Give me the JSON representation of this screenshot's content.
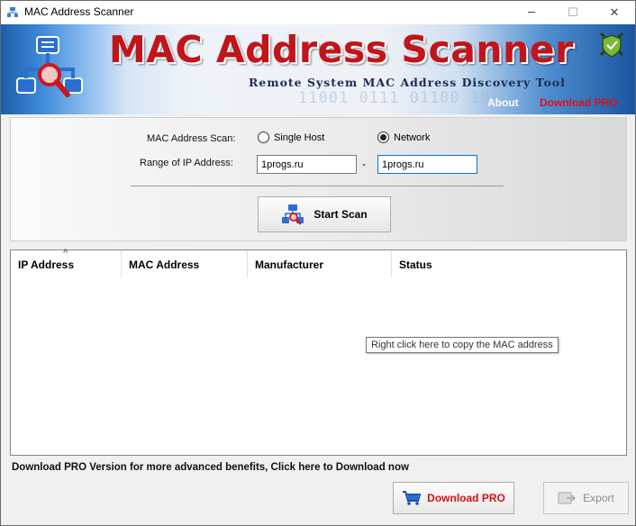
{
  "window": {
    "title": "MAC Address Scanner",
    "minimize_glyph": "─",
    "maximize_glyph": "☐",
    "close_glyph": "✕"
  },
  "banner": {
    "app_name": "MAC Address Scanner",
    "subtitle": "Remote System MAC Address Discovery Tool",
    "about_label": "About",
    "download_pro_label": "Download PRO",
    "binary_bg": "11001 0111 01100 1011",
    "accent_color": "#c2141b"
  },
  "scan": {
    "mode_label": "MAC Address Scan:",
    "single_host_label": "Single Host",
    "network_label": "Network",
    "selected_mode": "Network",
    "range_label": "Range of IP Address:",
    "range_from": "1progs.ru",
    "range_to": "1progs.ru",
    "range_separator": "-",
    "start_label": "Start Scan"
  },
  "results": {
    "columns": [
      "IP Address",
      "MAC Address",
      "Manufacturer",
      "Status"
    ],
    "sort_indicator": "^",
    "rows": [],
    "tooltip": "Right click here to copy the MAC address"
  },
  "footer": {
    "promo_text": "Download PRO Version for more advanced benefits, Click here to Download now",
    "download_pro_label": "Download PRO",
    "export_label": "Export"
  }
}
